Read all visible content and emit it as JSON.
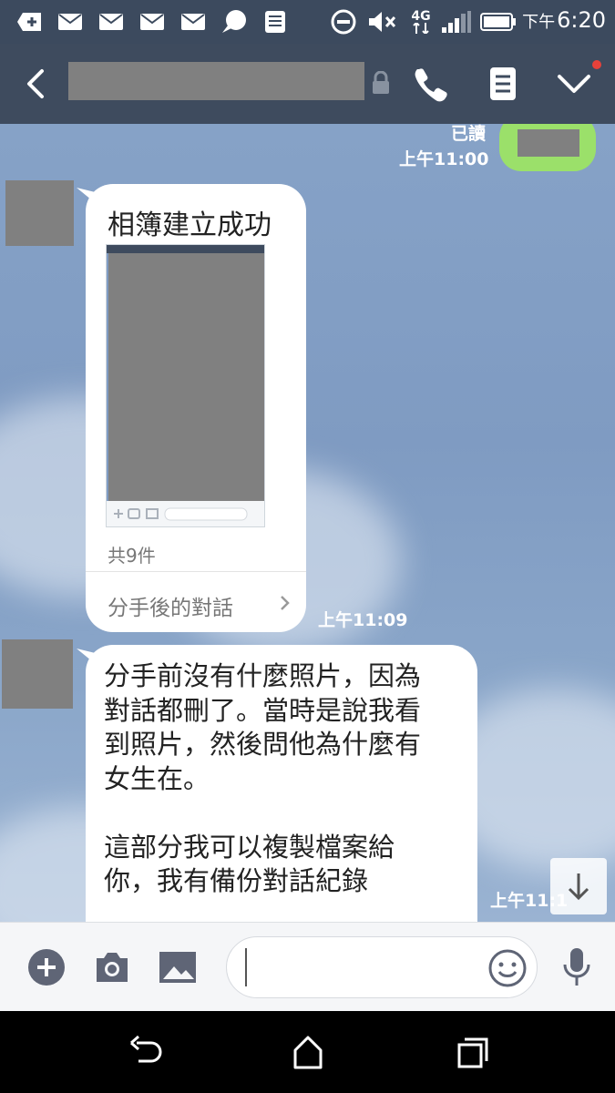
{
  "status_bar": {
    "ampm": "下午",
    "time": "6:20",
    "network": "4G",
    "icons": [
      "add-message-icon",
      "mail-icon",
      "mail-icon",
      "mail-icon",
      "mail-icon",
      "chat-bubble-icon",
      "list-icon",
      "do-not-disturb-icon",
      "mute-icon",
      "network-4g-icon",
      "signal-icon",
      "battery-icon"
    ]
  },
  "header": {
    "icons": [
      "back-icon",
      "lock-icon",
      "phone-icon",
      "notes-icon",
      "chevron-down-icon"
    ]
  },
  "messages": {
    "sent_1": {
      "read_label": "已讀",
      "time": "上午11:00"
    },
    "album": {
      "title": "相簿建立成功",
      "count": "共9件",
      "link": "分手後的對話",
      "time": "上午11:09"
    },
    "text_1": {
      "text": "分手前沒有什麼照片，因為\n對話都刪了。當時是說我看\n到照片，然後問他為什麼有\n女生在。\n\n這部分我可以複製檔案給\n你，我有備份對話紀錄",
      "time": "上午11:1"
    }
  },
  "input_bar": {
    "placeholder": "",
    "icons": [
      "plus-icon",
      "camera-icon",
      "image-icon",
      "emoji-icon",
      "microphone-icon"
    ]
  },
  "nav_bar": {
    "icons": [
      "nav-back-icon",
      "home-icon",
      "recent-apps-icon"
    ]
  },
  "colors": {
    "header_bg": "#3e4b5e",
    "chat_bg": "#86a2c7",
    "sent_bubble": "#9be06a",
    "notification_dot": "#e8413a"
  }
}
